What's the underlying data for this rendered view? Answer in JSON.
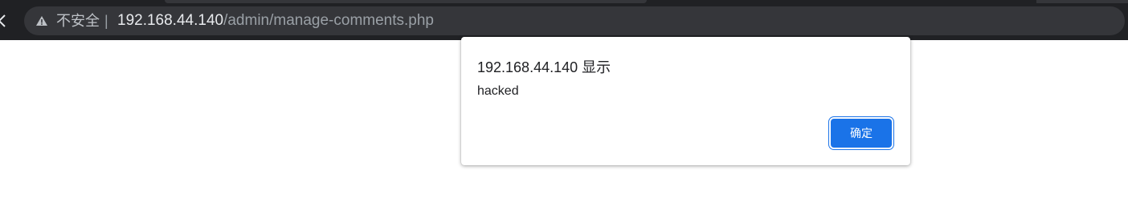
{
  "browser": {
    "back_glyph": "‹",
    "security_icon": "warning-triangle-icon",
    "security_label": "不安全",
    "separator": "|",
    "url_host": "192.168.44.140",
    "url_path": "/admin/manage-comments.php"
  },
  "alert": {
    "title": "192.168.44.140 显示",
    "message": "hacked",
    "ok_label": "确定"
  },
  "colors": {
    "toolbar_bg": "#202124",
    "omnibox_bg": "#35363a",
    "button_blue": "#1a73e8"
  }
}
